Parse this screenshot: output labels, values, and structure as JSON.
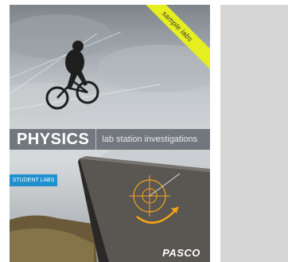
{
  "cover": {
    "corner_banner": "sample labs",
    "title": "PHYSICS",
    "subtitle": "lab station investigations",
    "badge": "STUDENT LABS",
    "brand": "PASCO"
  },
  "colors": {
    "banner": "#e6ee1f",
    "badge": "#1e8fcf",
    "title_bar": "#5a6068",
    "placeholder": "#d6d6d6",
    "arc": "#f2a516"
  },
  "icons": {
    "cyclist_silhouette": "cyclist",
    "ramp_graphic": "ramp",
    "target_diagram": "target"
  }
}
